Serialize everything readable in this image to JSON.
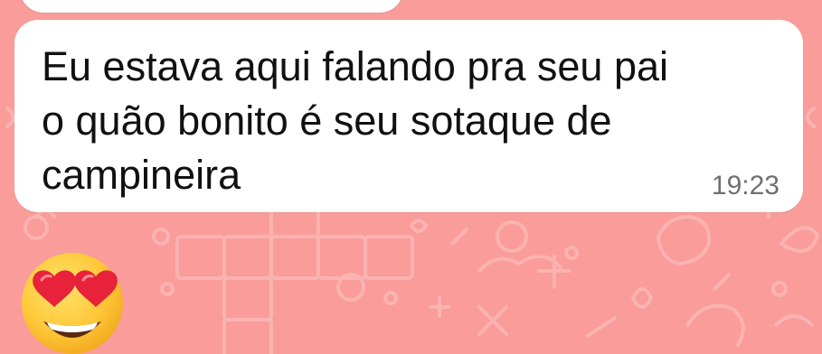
{
  "colors": {
    "wallpaper": "#f99c9a",
    "doodle": "#fbb3b1",
    "bubble": "#ffffff",
    "text": "#111111",
    "time": "#6f6f6f"
  },
  "message": {
    "text": "Eu estava aqui falando pra seu pai\no quão bonito é seu sotaque de\ncampineira",
    "time": "19:23"
  },
  "emoji_message": {
    "icon": "heart-eyes-emoji"
  }
}
